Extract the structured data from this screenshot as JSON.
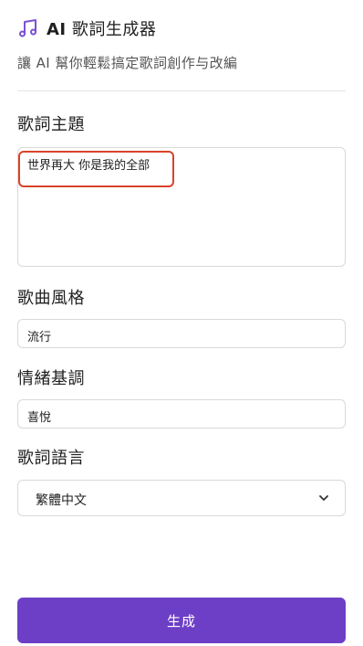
{
  "header": {
    "icon": "music-note-icon",
    "title_ai": "AI",
    "title_rest": " 歌詞生成器",
    "subtitle": "讓 AI 幫你輕鬆搞定歌詞創作与改編"
  },
  "form": {
    "theme": {
      "label": "歌詞主題",
      "value": "世界再大 你是我的全部"
    },
    "style": {
      "label": "歌曲風格",
      "value": "流行"
    },
    "mood": {
      "label": "情緒基調",
      "value": "喜悅"
    },
    "language": {
      "label": "歌詞語言",
      "selected": "繁體中文",
      "icon": "chevron-down-icon"
    }
  },
  "actions": {
    "generate_label": "生成"
  },
  "colors": {
    "accent": "#6c3fc6",
    "highlight": "#d9432a"
  }
}
